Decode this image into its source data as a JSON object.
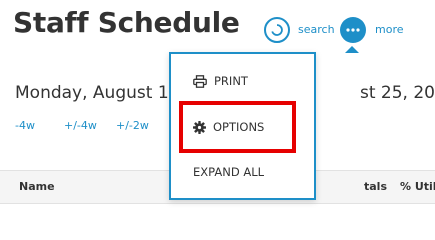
{
  "page": {
    "title": "Staff Schedule",
    "search_label": "search",
    "more_label": "more"
  },
  "date_range": {
    "start_visible": "Monday, August 1",
    "end_visible": "st 25, 20"
  },
  "nav_links": [
    "-4w",
    "+/-4w",
    "+/-2w"
  ],
  "table": {
    "headers": [
      "Name",
      "tals",
      "% Util"
    ]
  },
  "menu": {
    "items": [
      {
        "label": "PRINT",
        "icon": "printer-icon"
      },
      {
        "label": "OPTIONS",
        "icon": "gear-icon"
      },
      {
        "label": "EXPAND ALL",
        "icon": ""
      }
    ],
    "highlighted": "OPTIONS"
  },
  "colors": {
    "accent": "#1e8fc8",
    "highlight": "#e60000"
  }
}
